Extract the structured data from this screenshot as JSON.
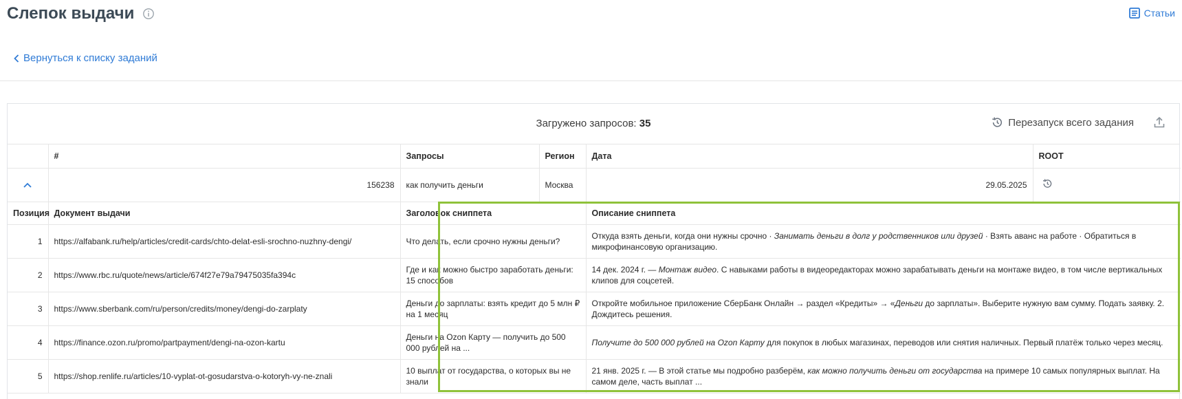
{
  "header": {
    "title": "Слепок выдачи",
    "articles_label": "Статьи",
    "back_label": "Вернуться к списку заданий"
  },
  "summary": {
    "loaded_label": "Загружено запросов:",
    "loaded_count": "35",
    "restart_label": "Перезапуск всего задания"
  },
  "task_table": {
    "columns": [
      "#",
      "Запросы",
      "Регион",
      "Дата",
      "ROOT"
    ],
    "row": {
      "id": "156238",
      "query": "как получить деньги",
      "region": "Москва",
      "date": "29.05.2025"
    }
  },
  "results_table": {
    "columns": [
      "Позиция",
      "Документ выдачи",
      "Заголовок сниппета",
      "Описание сниппета"
    ],
    "rows": [
      {
        "position": "1",
        "url": "https://alfabank.ru/help/articles/credit-cards/chto-delat-esli-srochno-nuzhny-dengi/",
        "title": "Что делать, если срочно нужны деньги?",
        "desc_parts": [
          "Откуда взять деньги, когда они нужны срочно · ",
          "Занимать деньги в долг у родственников или друзей",
          " · Взять аванс на работе · Обратиться в микрофинансовую организацию."
        ]
      },
      {
        "position": "2",
        "url": "https://www.rbc.ru/quote/news/article/674f27e79a79475035fa394c",
        "title": "Где и как можно быстро заработать деньги: 15 способов",
        "desc_parts": [
          "14 дек. 2024 г. — ",
          "Монтаж видео",
          ". С навыками работы в видеоредакторах можно зарабатывать деньги на монтаже видео, в том числе вертикальных клипов для соцсетей."
        ]
      },
      {
        "position": "3",
        "url": "https://www.sberbank.com/ru/person/credits/money/dengi-do-zarplaty",
        "title": "Деньги до зарплаты: взять кредит до 5 млн ₽ на 1 месяц",
        "desc_parts": [
          "Откройте мобильное приложение СберБанк Онлайн → раздел «Кредиты» → «",
          "Деньги",
          " до зарплаты». Выберите нужную вам сумму. Подать заявку. 2. Дождитесь решения."
        ]
      },
      {
        "position": "4",
        "url": "https://finance.ozon.ru/promo/partpayment/dengi-na-ozon-kartu",
        "title": "Деньги на Ozon Карту — получить до 500 000 рублей на ...",
        "desc_parts": [
          "",
          "Получите до 500 000 рублей на Ozon Карту",
          " для покупок в любых магазинах, переводов или снятия наличных. Первый платёж только через месяц."
        ]
      },
      {
        "position": "5",
        "url": "https://shop.renlife.ru/articles/10-vyplat-ot-gosudarstva-o-kotoryh-vy-ne-znali",
        "title": "10 выплат от государства, о которых вы не знали",
        "desc_parts": [
          "21 янв. 2025 г. — В этой статье мы подробно разберём, ",
          "как можно получить деньги от государства",
          " на примере 10 самых популярных выплат. На самом деле, часть выплат ..."
        ]
      }
    ]
  },
  "colors": {
    "link": "#2f7bd6",
    "highlight_border": "#8fc23a",
    "title": "#3c4a56"
  }
}
